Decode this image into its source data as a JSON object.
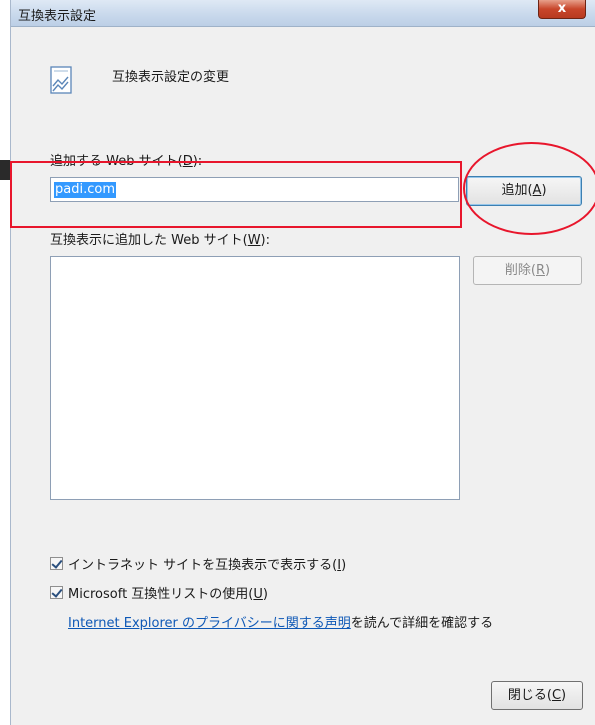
{
  "window": {
    "title": "互換表示設定",
    "close_label": "x",
    "header_text": "互換表示設定の変更"
  },
  "add_site": {
    "label_prefix": "追加する Web サイト(",
    "label_key": "D",
    "label_suffix": "):",
    "input_value": "padi.com",
    "add_button_prefix": "追加(",
    "add_button_key": "A",
    "add_button_suffix": ")"
  },
  "added_sites": {
    "label_prefix": "互換表示に追加した Web サイト(",
    "label_key": "W",
    "label_suffix": "):",
    "items": [],
    "remove_button_prefix": "削除(",
    "remove_button_key": "R",
    "remove_button_suffix": ")"
  },
  "options": {
    "intranet_prefix": "イントラネット サイトを互換表示で表示する(",
    "intranet_key": "I",
    "intranet_suffix": ")",
    "intranet_checked": true,
    "ms_list_prefix": "Microsoft 互換性リストの使用(",
    "ms_list_key": "U",
    "ms_list_suffix": ")",
    "ms_list_checked": true
  },
  "privacy": {
    "link_text": "Internet Explorer のプライバシーに関する声明",
    "after_text": "を読んで詳細を確認する"
  },
  "footer": {
    "close_button_prefix": "閉じる(",
    "close_button_key": "C",
    "close_button_suffix": ")"
  },
  "colors": {
    "annotation": "#e8162c",
    "selection": "#3399ff",
    "link": "#0e58b6"
  }
}
